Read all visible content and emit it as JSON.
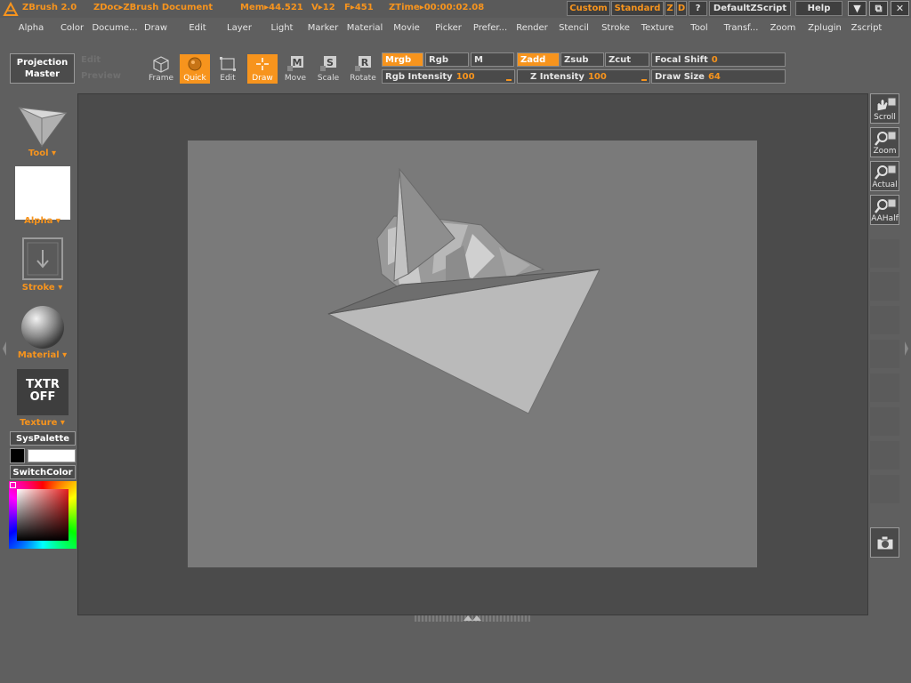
{
  "title_bar": {
    "app": "ZBrush 2.0",
    "doc": "ZDoc▸ZBrush Document",
    "mem": "Mem▸44.521",
    "verts": "V▸12",
    "faces": "F▸451",
    "ztime": "ZTime▸00:00:02.08",
    "custom": "Custom",
    "standard": "Standard",
    "z": "Z",
    "d": "D",
    "q": "?",
    "script": "DefaultZScript",
    "help": "Help",
    "min": "▼",
    "restore": "⧉",
    "close": "✕"
  },
  "menu": [
    "Alpha",
    "Color",
    "Docume...",
    "Draw",
    "Edit",
    "Layer",
    "Light",
    "Marker",
    "Material",
    "Movie",
    "Picker",
    "Prefer...",
    "Render",
    "Stencil",
    "Stroke",
    "Texture",
    "Tool",
    "Transf...",
    "Zoom",
    "Zplugin",
    "Zscript"
  ],
  "toolbar": {
    "projection_master": "Projection Master",
    "ghost_1": "Edit",
    "ghost_2": "Preview",
    "frame": "Frame",
    "quick": "Quick",
    "edit": "Edit",
    "draw": "Draw",
    "move": "Move",
    "scale": "Scale",
    "rotate": "Rotate",
    "mrgb": "Mrgb",
    "rgb": "Rgb",
    "m": "M",
    "zadd": "Zadd",
    "zsub": "Zsub",
    "zcut": "Zcut",
    "focal_shift_label": "Focal Shift",
    "focal_shift_value": "0",
    "rgb_intensity_label": "Rgb Intensity",
    "rgb_intensity_value": "100",
    "z_intensity_label": "Z Intensity",
    "z_intensity_value": "100",
    "draw_size_label": "Draw Size",
    "draw_size_value": "64"
  },
  "left_panel": {
    "tool": "Tool",
    "alpha": "Alpha",
    "stroke": "Stroke",
    "material": "Material",
    "texture_thumb": "TXTR OFF",
    "texture": "Texture",
    "syspalette": "SysPalette",
    "switchcolor": "SwitchColor",
    "primary_color": "#000000",
    "secondary_color": "#ffffff"
  },
  "right_panel": {
    "scroll": "Scroll",
    "zoom": "Zoom",
    "actual": "Actual",
    "aahalf": "AAHalf"
  },
  "colors": {
    "accent": "#f7941d",
    "background": "#5f5f5f",
    "canvas": "#7a7a7a"
  }
}
